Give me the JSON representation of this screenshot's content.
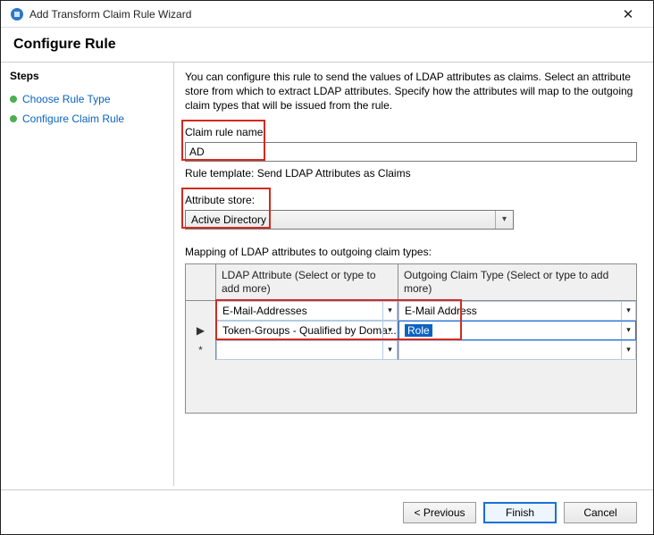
{
  "window": {
    "title": "Add Transform Claim Rule Wizard",
    "close_glyph": "✕"
  },
  "heading": "Configure Rule",
  "sidebar": {
    "steps_title": "Steps",
    "items": [
      {
        "label": "Choose Rule Type"
      },
      {
        "label": "Configure Claim Rule"
      }
    ]
  },
  "content": {
    "description": "You can configure this rule to send the values of LDAP attributes as claims. Select an attribute store from which to extract LDAP attributes. Specify how the attributes will map to the outgoing claim types that will be issued from the rule.",
    "claim_rule_name_label": "Claim rule name:",
    "claim_rule_name_value": "AD",
    "rule_template_label": "Rule template: Send LDAP Attributes as Claims",
    "attribute_store_label": "Attribute store:",
    "attribute_store_value": "Active Directory",
    "mapping_label": "Mapping of LDAP attributes to outgoing claim types:",
    "grid": {
      "headers": {
        "col1": "LDAP Attribute (Select or type to add more)",
        "col2": "Outgoing Claim Type (Select or type to add more)"
      },
      "rows": [
        {
          "marker": "",
          "ldap": "E-Mail-Addresses",
          "claim": "E-Mail Address",
          "claim_selected": false
        },
        {
          "marker": "▶",
          "ldap": "Token-Groups - Qualified by Doma...",
          "claim": "Role",
          "claim_selected": true
        },
        {
          "marker": "*",
          "ldap": "",
          "claim": "",
          "claim_selected": false
        }
      ]
    }
  },
  "footer": {
    "previous": "< Previous",
    "finish": "Finish",
    "cancel": "Cancel"
  }
}
